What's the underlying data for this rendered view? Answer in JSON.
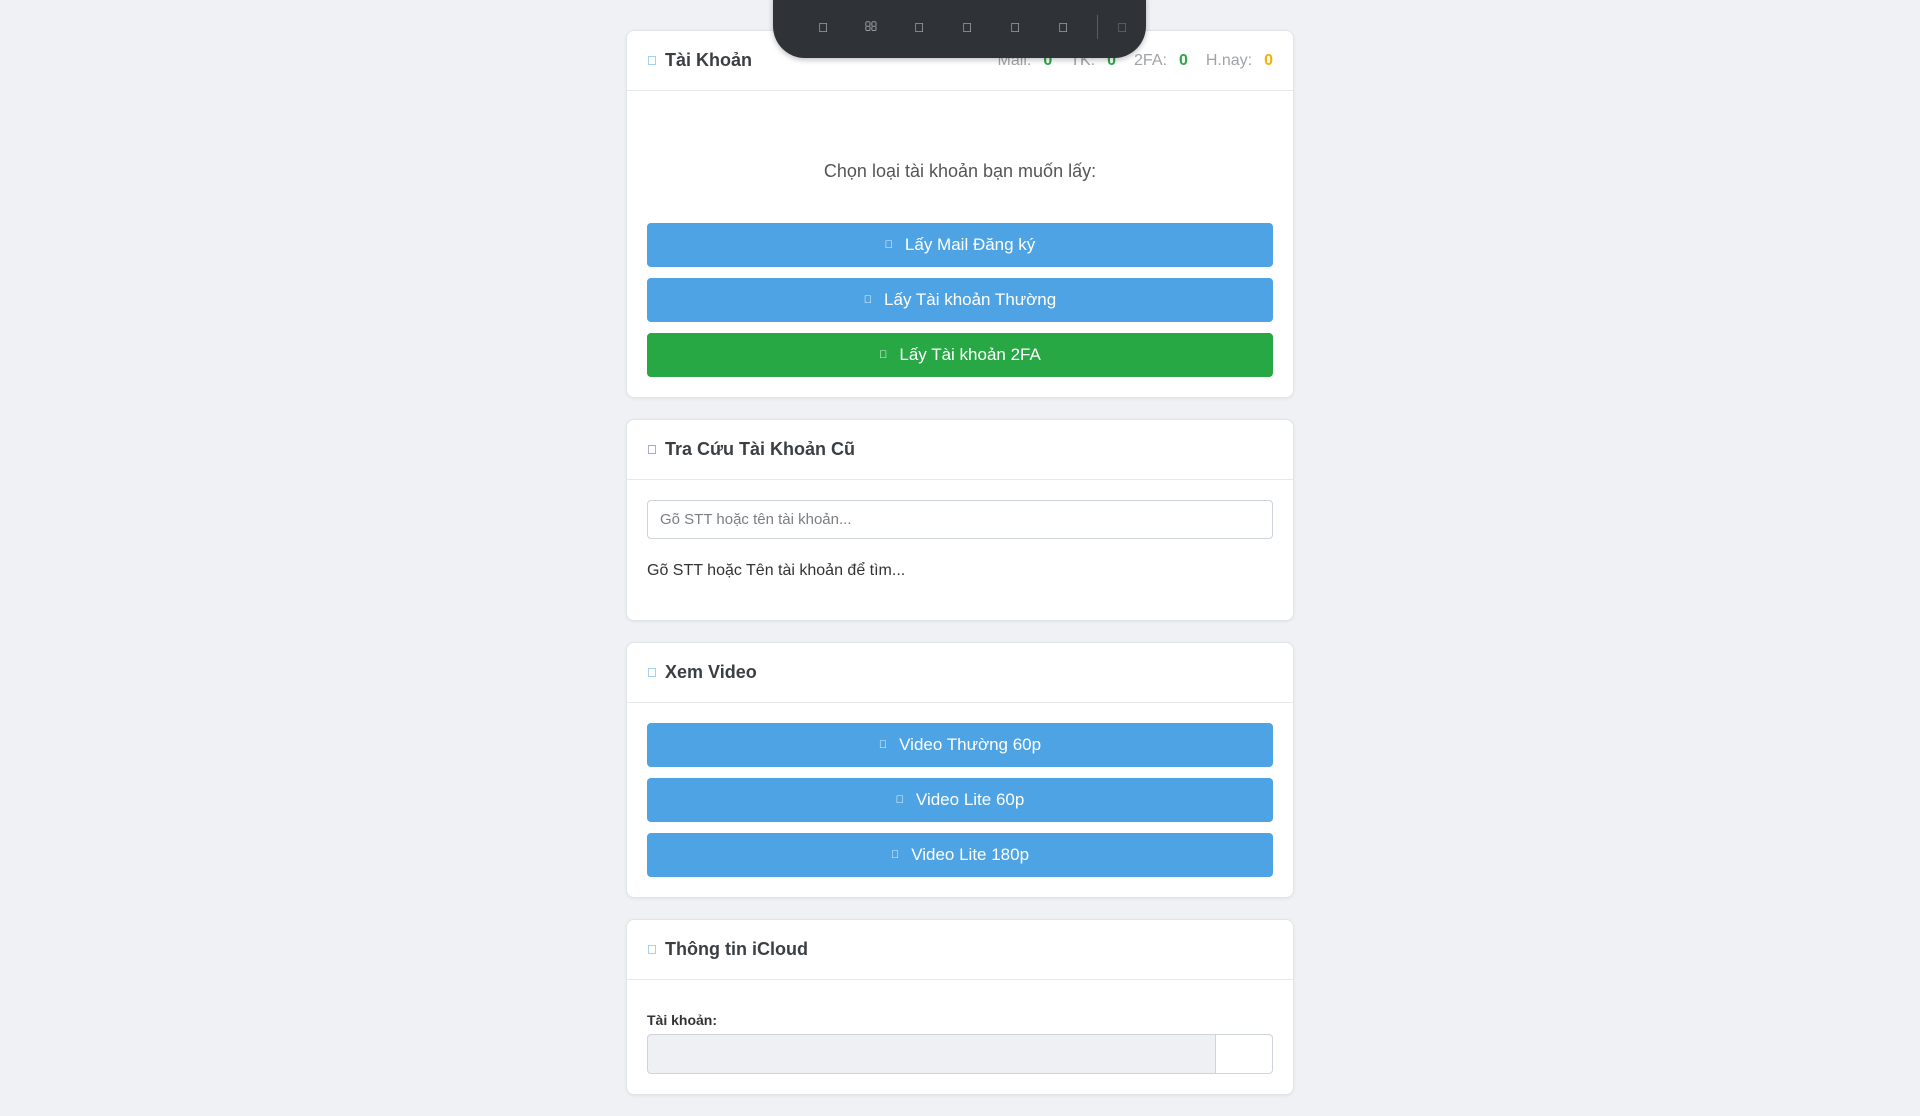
{
  "toolbar": {
    "icons": [
      "user-icon",
      "search-icon",
      "video-icon",
      "cloud-icon",
      "settings-icon",
      "gear-icon",
      "power-icon"
    ],
    "glyphs": [
      "",
      "",
      "",
      "",
      "",
      "",
      ""
    ]
  },
  "account_card": {
    "icon": "user-icon",
    "icon_glyph": "",
    "title": "Tài Khoản",
    "stats": [
      {
        "label": "Mail:",
        "value": "0",
        "color": "#28a745"
      },
      {
        "label": "TK:",
        "value": "0",
        "color": "#28a745"
      },
      {
        "label": "2FA:",
        "value": "0",
        "color": "#28a745"
      },
      {
        "label": "H.nay:",
        "value": "0",
        "color": "#f0b400"
      }
    ],
    "prompt": "Chọn loại tài khoản bạn muốn lấy:",
    "buttons": [
      {
        "label": "Lấy Mail Đăng ký",
        "icon": "envelope-icon",
        "glyph": "",
        "color": "#4ea3e4"
      },
      {
        "label": "Lấy Tài khoản Thường",
        "icon": "user-icon",
        "glyph": "",
        "color": "#4ea3e4"
      },
      {
        "label": "Lấy Tài khoản 2FA",
        "icon": "shield-icon",
        "glyph": "",
        "color": "#28a745"
      }
    ]
  },
  "lookup_card": {
    "icon": "history-icon",
    "icon_glyph": "",
    "title": "Tra Cứu Tài Khoản Cũ",
    "placeholder": "Gõ STT hoặc tên tài khoản...",
    "hint": "Gõ STT hoặc Tên tài khoản để tìm..."
  },
  "video_card": {
    "icon": "video-icon",
    "icon_glyph": "",
    "title": "Xem Video",
    "buttons": [
      {
        "label": "Video Thường 60p",
        "icon": "play-icon",
        "glyph": "",
        "color": "#4ea3e4"
      },
      {
        "label": "Video Lite 60p",
        "icon": "play-icon",
        "glyph": "",
        "color": "#4ea3e4"
      },
      {
        "label": "Video Lite 180p",
        "icon": "play-icon",
        "glyph": "",
        "color": "#4ea3e4"
      }
    ]
  },
  "icloud_card": {
    "icon": "cloud-icon",
    "icon_glyph": "",
    "title": "Thông tin iCloud",
    "account_label": "Tài khoản:"
  },
  "colors": {
    "header_icon_blue": "#4ea3e4",
    "lookup_icon_purple": "#6f42c1"
  }
}
